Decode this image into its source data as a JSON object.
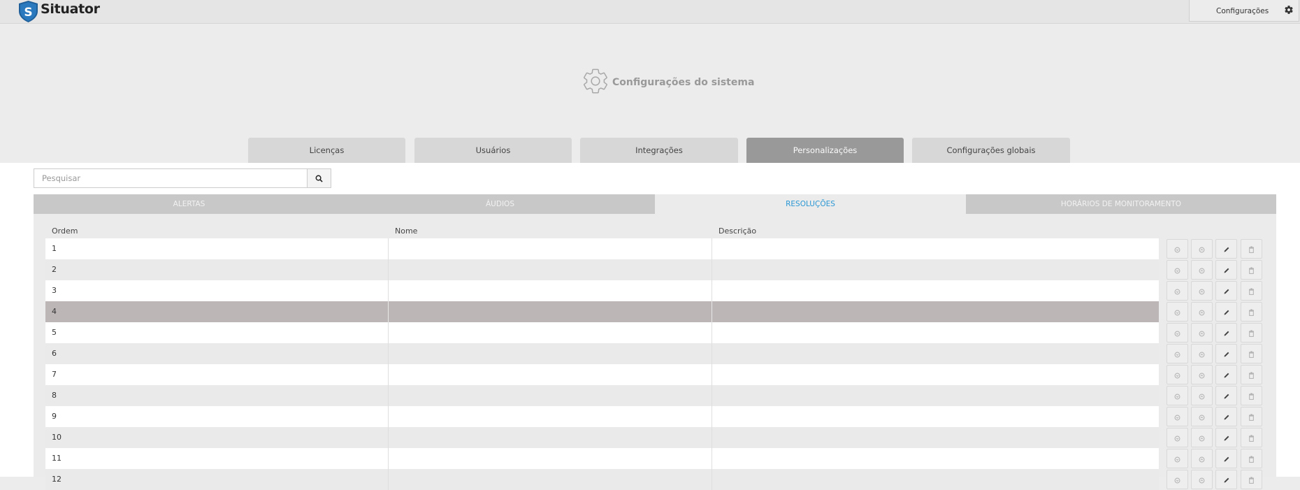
{
  "header": {
    "app_name": "Situator",
    "logo_letter": "S",
    "config_label": "Configurações"
  },
  "page": {
    "title": "Configurações do sistema"
  },
  "tabs": [
    {
      "label": "Licenças",
      "active": false
    },
    {
      "label": "Usuários",
      "active": false
    },
    {
      "label": "Integrações",
      "active": false
    },
    {
      "label": "Personalizações",
      "active": true
    },
    {
      "label": "Configurações globais",
      "active": false
    }
  ],
  "search": {
    "placeholder": "Pesquisar",
    "value": ""
  },
  "subtabs": [
    {
      "label": "ALERTAS",
      "active": false
    },
    {
      "label": "ÁUDIOS",
      "active": false
    },
    {
      "label": "RESOLUÇÕES",
      "active": true
    },
    {
      "label": "HORÁRIOS DE MONITORAMENTO",
      "active": false
    }
  ],
  "table": {
    "columns": [
      "Ordem",
      "Nome",
      "Descrição"
    ],
    "selected_row": "4",
    "rows": [
      {
        "ordem": "1",
        "nome": "",
        "descricao": ""
      },
      {
        "ordem": "2",
        "nome": "",
        "descricao": ""
      },
      {
        "ordem": "3",
        "nome": "",
        "descricao": ""
      },
      {
        "ordem": "4",
        "nome": "",
        "descricao": ""
      },
      {
        "ordem": "5",
        "nome": "",
        "descricao": ""
      },
      {
        "ordem": "6",
        "nome": "",
        "descricao": ""
      },
      {
        "ordem": "7",
        "nome": "",
        "descricao": ""
      },
      {
        "ordem": "8",
        "nome": "",
        "descricao": ""
      },
      {
        "ordem": "9",
        "nome": "",
        "descricao": ""
      },
      {
        "ordem": "10",
        "nome": "",
        "descricao": ""
      },
      {
        "ordem": "11",
        "nome": "",
        "descricao": ""
      },
      {
        "ordem": "12",
        "nome": "",
        "descricao": ""
      }
    ],
    "row_actions": [
      "move-down-icon",
      "move-up-icon",
      "edit-icon",
      "delete-icon"
    ]
  },
  "colors": {
    "accent": "#2a97d4",
    "active_tab": "#999999",
    "selected_row": "#bdb6b7"
  }
}
